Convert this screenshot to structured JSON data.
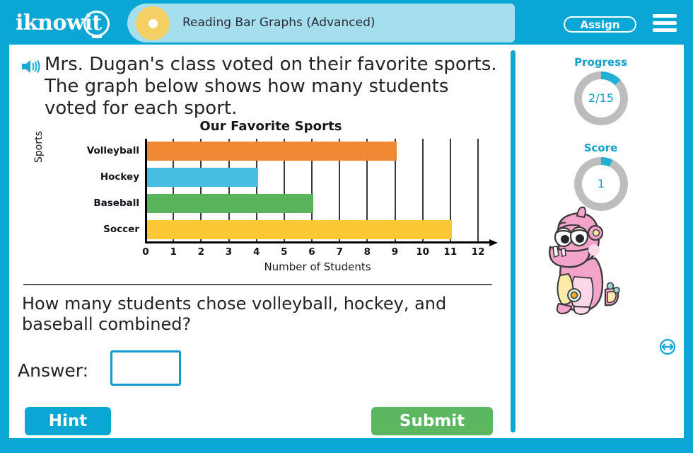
{
  "header": {
    "logo_text": "iknowit",
    "logo_icon": "lightbulb-icon",
    "title": "Reading Bar Graphs (Advanced)",
    "assign_label": "Assign",
    "menu_icon": "hamburger-menu-icon",
    "brand_color": "#0AA6D4",
    "pill_color": "#A5DEED",
    "dot_color": "#F4CF64"
  },
  "question": {
    "speaker_icon": "speaker-audio-icon",
    "prompt": "Mrs. Dugan's class voted on their favorite sports. The graph below shows how many students voted for each sport.",
    "text": "How many students chose volleyball, hockey, and baseball combined?",
    "answer_label": "Answer:",
    "answer_value": "",
    "answer_placeholder": ""
  },
  "chart_data": {
    "type": "bar",
    "orientation": "horizontal",
    "title": "Our Favorite Sports",
    "xlabel": "Number of Students",
    "ylabel": "Sports",
    "categories": [
      "Volleyball",
      "Hockey",
      "Baseball",
      "Soccer"
    ],
    "values": [
      9,
      4,
      6,
      11
    ],
    "colors": [
      "#F08733",
      "#46BDE1",
      "#58B35A",
      "#FBC734"
    ],
    "xlim": [
      0,
      12
    ],
    "xticks": [
      0,
      1,
      2,
      3,
      4,
      5,
      6,
      7,
      8,
      9,
      10,
      11,
      12
    ],
    "xtick_labels": [
      "0",
      "1",
      "2",
      "3",
      "4",
      "5",
      "6",
      "7",
      "8",
      "9",
      "10",
      "11",
      "12"
    ],
    "grid": true,
    "grid_axis": "x",
    "legend": false
  },
  "buttons": {
    "hint_label": "Hint",
    "hint_color": "#0AA6D4",
    "submit_label": "Submit",
    "submit_color": "#5CB860"
  },
  "sidebar": {
    "progress_title": "Progress",
    "progress_value": "2/15",
    "progress_percent": 13,
    "score_title": "Score",
    "score_value": "1",
    "score_percent": 7,
    "meter_track_color": "#BDBDBD",
    "meter_fill_color": "#20AFD6",
    "mascot_name": "pink-monster-mascot",
    "resize_icon": "resize-arrows-icon"
  },
  "scrollbar": {
    "name": "vertical-scrollbar",
    "color": "#0FA8D6"
  }
}
